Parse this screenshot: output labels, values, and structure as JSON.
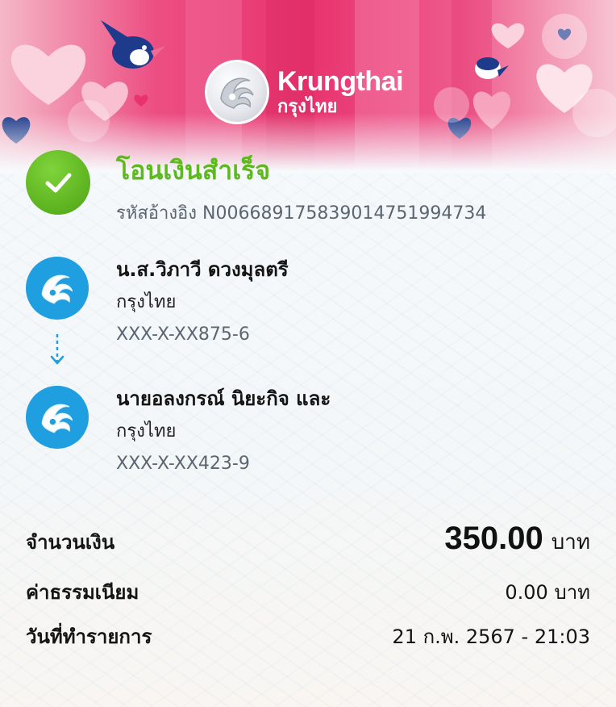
{
  "brand": {
    "name_en": "Krungthai",
    "name_th": "กรุงไทย"
  },
  "status": {
    "title": "โอนเงินสำเร็จ",
    "reference": "รหัสอ้างอิง N006689175839014751994734",
    "icon": "check-icon",
    "color": "#5eb81f"
  },
  "sender": {
    "name": "น.ส.วิภาวี ดวงมุลตรี",
    "bank": "กรุงไทย",
    "account": "XXX-X-XX875-6"
  },
  "receiver": {
    "name": "นายอลงกรณ์ นิยะกิจ และ",
    "bank": "กรุงไทย",
    "account": "XXX-X-XX423-9"
  },
  "details": {
    "amount_label": "จำนวนเงิน",
    "amount_value": "350.00",
    "amount_unit": "บาท",
    "fee_label": "ค่าธรรมเนียม",
    "fee_value": "0.00 บาท",
    "date_label": "วันที่ทำรายการ",
    "date_value": "21 ก.พ. 2567 - 21:03"
  },
  "colors": {
    "accent_blue": "#1f9ee0",
    "banner_pink": "#e8336f"
  }
}
